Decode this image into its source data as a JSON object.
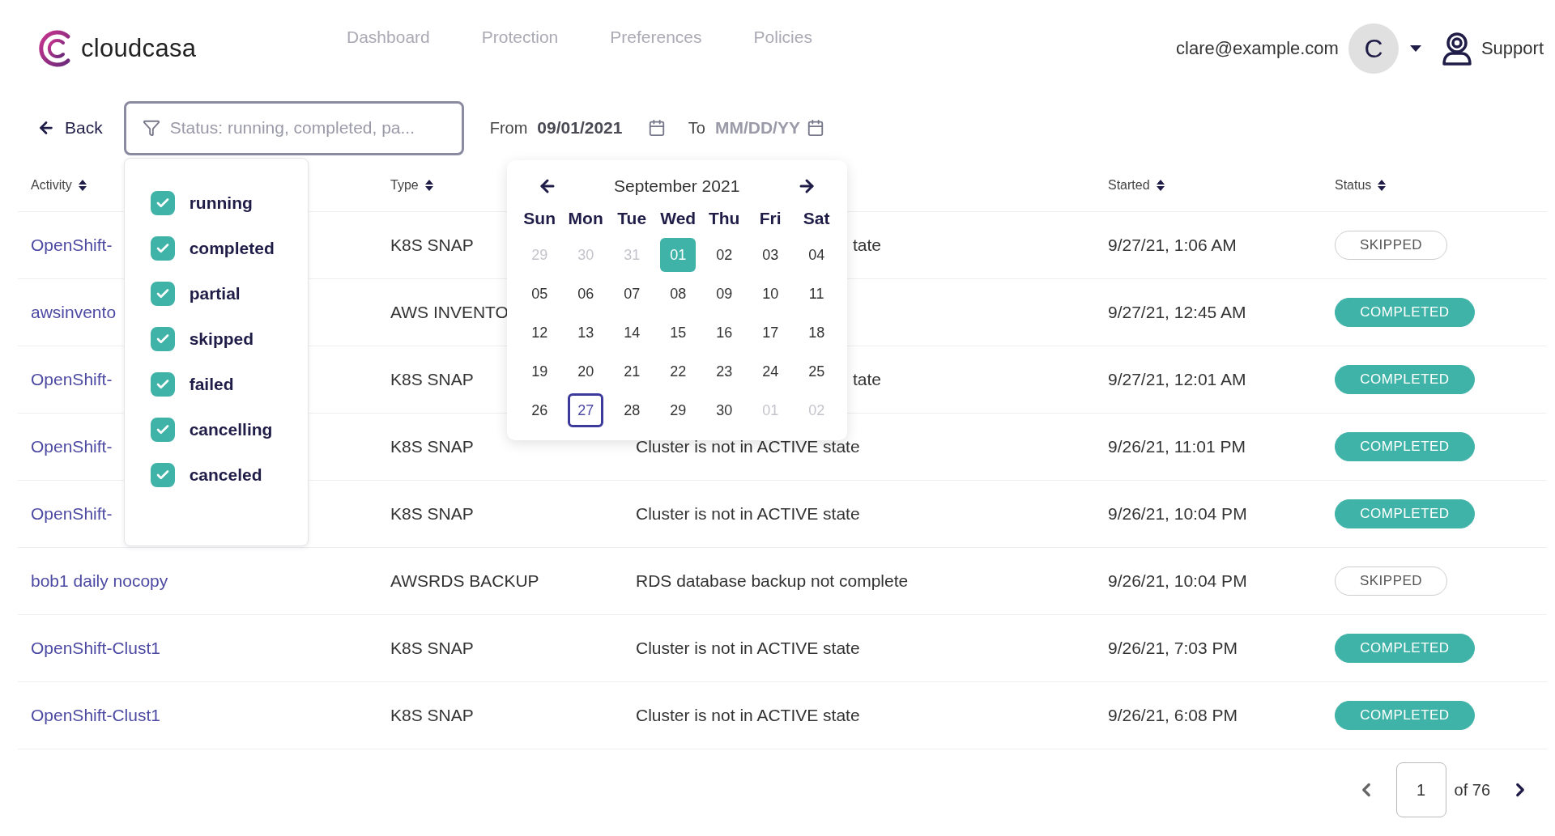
{
  "header": {
    "brand": "cloudcasa",
    "nav": [
      {
        "label": "Dashboard",
        "selected": false
      },
      {
        "label": "Protection",
        "selected": false
      },
      {
        "label": "Preferences",
        "selected": false
      },
      {
        "label": "Policies",
        "selected": false
      }
    ],
    "user": {
      "email": "clare@example.com",
      "avatar_initial": "C"
    },
    "support": "Support"
  },
  "toolbar": {
    "back": "Back",
    "filter": {
      "placeholder": "Status: running, completed, pa..."
    },
    "from": {
      "label": "From",
      "value": "09/01/2021"
    },
    "to": {
      "label": "To",
      "placeholder": "MM/DD/YY"
    }
  },
  "filter_menu": {
    "options": [
      {
        "label": "running",
        "checked": true
      },
      {
        "label": "completed",
        "checked": true
      },
      {
        "label": "partial",
        "checked": true
      },
      {
        "label": "skipped",
        "checked": true
      },
      {
        "label": "failed",
        "checked": true
      },
      {
        "label": "cancelling",
        "checked": true
      },
      {
        "label": "canceled",
        "checked": true
      }
    ]
  },
  "calendar": {
    "month": "September 2021",
    "weekdays": [
      "Sun",
      "Mon",
      "Tue",
      "Wed",
      "Thu",
      "Fri",
      "Sat"
    ],
    "weeks": [
      [
        {
          "day": "29",
          "outside": true,
          "selected": false,
          "today": false
        },
        {
          "day": "30",
          "outside": true,
          "selected": false,
          "today": false
        },
        {
          "day": "31",
          "outside": true,
          "selected": false,
          "today": false
        },
        {
          "day": "01",
          "outside": false,
          "selected": true,
          "today": false
        },
        {
          "day": "02",
          "outside": false,
          "selected": false,
          "today": false
        },
        {
          "day": "03",
          "outside": false,
          "selected": false,
          "today": false
        },
        {
          "day": "04",
          "outside": false,
          "selected": false,
          "today": false
        }
      ],
      [
        {
          "day": "05",
          "outside": false,
          "selected": false,
          "today": false
        },
        {
          "day": "06",
          "outside": false,
          "selected": false,
          "today": false
        },
        {
          "day": "07",
          "outside": false,
          "selected": false,
          "today": false
        },
        {
          "day": "08",
          "outside": false,
          "selected": false,
          "today": false
        },
        {
          "day": "09",
          "outside": false,
          "selected": false,
          "today": false
        },
        {
          "day": "10",
          "outside": false,
          "selected": false,
          "today": false
        },
        {
          "day": "11",
          "outside": false,
          "selected": false,
          "today": false
        }
      ],
      [
        {
          "day": "12",
          "outside": false,
          "selected": false,
          "today": false
        },
        {
          "day": "13",
          "outside": false,
          "selected": false,
          "today": false
        },
        {
          "day": "14",
          "outside": false,
          "selected": false,
          "today": false
        },
        {
          "day": "15",
          "outside": false,
          "selected": false,
          "today": false
        },
        {
          "day": "16",
          "outside": false,
          "selected": false,
          "today": false
        },
        {
          "day": "17",
          "outside": false,
          "selected": false,
          "today": false
        },
        {
          "day": "18",
          "outside": false,
          "selected": false,
          "today": false
        }
      ],
      [
        {
          "day": "19",
          "outside": false,
          "selected": false,
          "today": false
        },
        {
          "day": "20",
          "outside": false,
          "selected": false,
          "today": false
        },
        {
          "day": "21",
          "outside": false,
          "selected": false,
          "today": false
        },
        {
          "day": "22",
          "outside": false,
          "selected": false,
          "today": false
        },
        {
          "day": "23",
          "outside": false,
          "selected": false,
          "today": false
        },
        {
          "day": "24",
          "outside": false,
          "selected": false,
          "today": false
        },
        {
          "day": "25",
          "outside": false,
          "selected": false,
          "today": false
        }
      ],
      [
        {
          "day": "26",
          "outside": false,
          "selected": false,
          "today": false
        },
        {
          "day": "27",
          "outside": false,
          "selected": false,
          "today": true
        },
        {
          "day": "28",
          "outside": false,
          "selected": false,
          "today": false
        },
        {
          "day": "29",
          "outside": false,
          "selected": false,
          "today": false
        },
        {
          "day": "30",
          "outside": false,
          "selected": false,
          "today": false
        },
        {
          "day": "01",
          "outside": true,
          "selected": false,
          "today": false
        },
        {
          "day": "02",
          "outside": true,
          "selected": false,
          "today": false
        }
      ]
    ]
  },
  "table": {
    "columns": [
      {
        "label": "Activity"
      },
      {
        "label": "Type"
      },
      {
        "label": "Started"
      },
      {
        "label": "Status"
      }
    ],
    "rows": [
      {
        "activity": "OpenShift-",
        "type": "K8S SNAP",
        "message_tail": "tate",
        "started": "9/27/21, 1:06 AM",
        "status": {
          "label": "SKIPPED",
          "kind": "skipped"
        }
      },
      {
        "activity": "awsinvento",
        "type": "AWS INVENTO",
        "started": "9/27/21, 12:45 AM",
        "status": {
          "label": "COMPLETED",
          "kind": "completed"
        }
      },
      {
        "activity": "OpenShift-",
        "type": "K8S SNAP",
        "message_tail": "tate",
        "started": "9/27/21, 12:01 AM",
        "status": {
          "label": "COMPLETED",
          "kind": "completed"
        }
      },
      {
        "activity": "OpenShift-",
        "type": "K8S SNAP",
        "message": "Cluster is not in ACTIVE state",
        "started": "9/26/21, 11:01 PM",
        "status": {
          "label": "COMPLETED",
          "kind": "completed"
        }
      },
      {
        "activity": "OpenShift-",
        "type": "K8S SNAP",
        "message": "Cluster is not in ACTIVE state",
        "started": "9/26/21, 10:04 PM",
        "status": {
          "label": "COMPLETED",
          "kind": "completed"
        }
      },
      {
        "activity": "bob1 daily nocopy",
        "type": "AWSRDS BACKUP",
        "message": "RDS database backup not complete",
        "started": "9/26/21, 10:04 PM",
        "status": {
          "label": "SKIPPED",
          "kind": "skipped"
        }
      },
      {
        "activity": "OpenShift-Clust1",
        "type": "K8S SNAP",
        "message": "Cluster is not in ACTIVE state",
        "started": "9/26/21, 7:03 PM",
        "status": {
          "label": "COMPLETED",
          "kind": "completed"
        }
      },
      {
        "activity": "OpenShift-Clust1",
        "type": "K8S SNAP",
        "message": "Cluster is not in ACTIVE state",
        "started": "9/26/21, 6:08 PM",
        "status": {
          "label": "COMPLETED",
          "kind": "completed"
        }
      }
    ]
  },
  "pagination": {
    "page": "1",
    "total": "of 76"
  }
}
